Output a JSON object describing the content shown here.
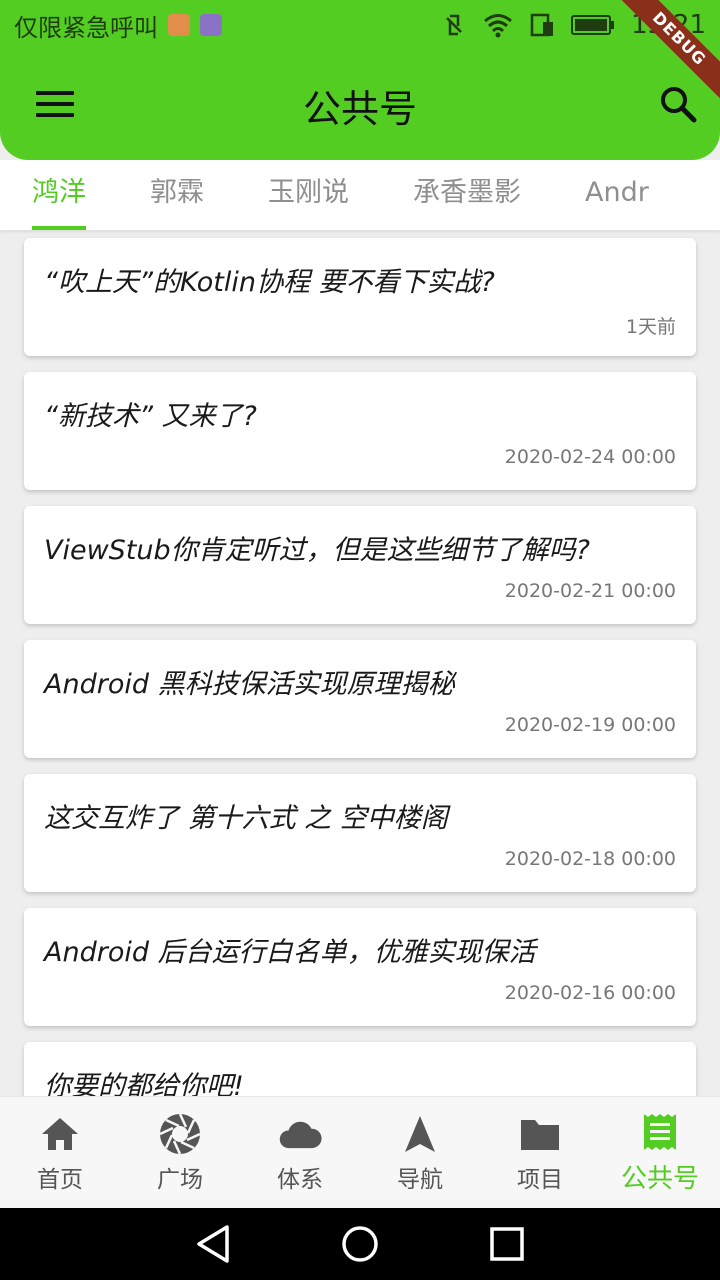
{
  "status_bar": {
    "carrier_text": "仅限紧急呼叫",
    "time": "15:21"
  },
  "debug_banner": "DEBUG",
  "app_bar": {
    "title": "公共号",
    "menu_icon": "menu-icon",
    "search_icon": "search-icon"
  },
  "tabs": [
    {
      "label": "鸿洋",
      "active": true
    },
    {
      "label": "郭霖",
      "active": false
    },
    {
      "label": "玉刚说",
      "active": false
    },
    {
      "label": "承香墨影",
      "active": false
    },
    {
      "label": "Andr",
      "active": false
    }
  ],
  "articles": [
    {
      "title": "“吹上天”的Kotlin协程 要不看下实战?",
      "date": "1天前"
    },
    {
      "title": "“新技术” 又来了?",
      "date": "2020-02-24 00:00"
    },
    {
      "title": "ViewStub你肯定听过，但是这些细节了解吗?",
      "date": "2020-02-21 00:00"
    },
    {
      "title": "Android 黑科技保活实现原理揭秘",
      "date": "2020-02-19 00:00"
    },
    {
      "title": "这交互炸了 第十六式 之 空中楼阁",
      "date": "2020-02-18 00:00"
    },
    {
      "title": "Android 后台运行白名单，优雅实现保活",
      "date": "2020-02-16 00:00"
    },
    {
      "title": "你要的都给你吧!",
      "date": ""
    }
  ],
  "bottom_nav": [
    {
      "label": "首页",
      "icon": "home-icon",
      "active": false
    },
    {
      "label": "广场",
      "icon": "aperture-icon",
      "active": false
    },
    {
      "label": "体系",
      "icon": "cloud-icon",
      "active": false
    },
    {
      "label": "导航",
      "icon": "navigation-arrow-icon",
      "active": false
    },
    {
      "label": "项目",
      "icon": "folder-icon",
      "active": false
    },
    {
      "label": "公共号",
      "icon": "receipt-icon",
      "active": true
    }
  ],
  "colors": {
    "accent": "#54cd23",
    "inactive": "#555555"
  }
}
